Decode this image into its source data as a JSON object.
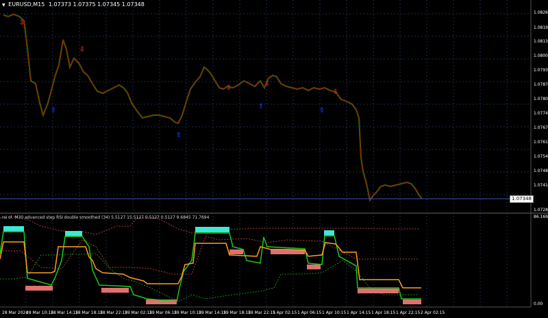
{
  "header": {
    "menu_icon": "triangle-down-icon",
    "symbol": "EURUSD,M15",
    "ohlc": "1.07373 1.07375 1.07345 1.07348"
  },
  "price_axis": {
    "labels": [
      "1.08260",
      "1.08195",
      "1.08130",
      "1.08000",
      "1.07935",
      "1.07870",
      "1.07805",
      "1.07740",
      "1.07675",
      "1.07610",
      "1.07545",
      "1.07480",
      "1.07415",
      "1.07285"
    ],
    "current_price": "1.07348"
  },
  "indicator": {
    "title": "rsi ol. M30 advanced step RSI double smoothed (34) 5.5127 15.5127 0.5127 0.5127 9.6845 71.7694",
    "axis_top": "86.1694",
    "axis_bottom": "0.00"
  },
  "time_axis": {
    "labels": [
      "28 Mar 2024",
      "28 Mar 10:15",
      "28 Mar 14:15",
      "28 Mar 18:15",
      "28 Mar 22:15",
      "29 Mar 02:15",
      "29 Mar 06:15",
      "29 Mar 10:15",
      "29 Mar 14:15",
      "29 Mar 18:15",
      "29 Mar 22:15",
      "1 Apr 02:15",
      "1 Apr 06:15",
      "1 Apr 10:15",
      "1 Apr 14:15",
      "1 Apr 18:15",
      "1 Apr 22:15",
      "2 Apr 02:15"
    ]
  },
  "colors": {
    "background": "#000000",
    "grid": "#1b2a4a",
    "bull": "#00c800",
    "bear": "#c80000",
    "signal_up": "#e0303a",
    "signal_down": "#1f3cff",
    "price_line": "#3b4fb0",
    "step_orange": "#ffa01e",
    "band_cyan": "#3ee8d4",
    "band_salmon": "#e07070",
    "dotted_red": "#b04040",
    "dotted_green": "#1e8e1e"
  },
  "chart_data": {
    "type": "candlestick",
    "price_series_close_approx": [
      1.0826,
      1.0823,
      1.0822,
      1.0815,
      1.079,
      1.0781,
      1.0779,
      1.0786,
      1.08,
      1.0808,
      1.08,
      1.08,
      1.0795,
      1.0787,
      1.0788,
      1.0787,
      1.0785,
      1.0782,
      1.078,
      1.0776,
      1.0776,
      1.0775,
      1.0776,
      1.0785,
      1.0798,
      1.0787,
      1.0789,
      1.0788,
      1.0789,
      1.0788,
      1.079,
      1.0786,
      1.0783,
      1.077,
      1.075,
      1.0742,
      1.074,
      1.0743,
      1.0742,
      1.0741,
      1.0736
    ],
    "up_arrows_at": [
      "28 Mar ~08:15",
      "28 Mar ~16:15",
      "29 Mar ~19:15",
      "1 Apr ~04:15",
      "1 Apr ~11:45"
    ],
    "down_arrows_at": [
      "28 Mar ~12:45",
      "29 Mar ~09:45",
      "1 Apr ~01:15",
      "1 Apr ~09:45"
    ],
    "ylim": [
      1.07285,
      1.083
    ]
  }
}
